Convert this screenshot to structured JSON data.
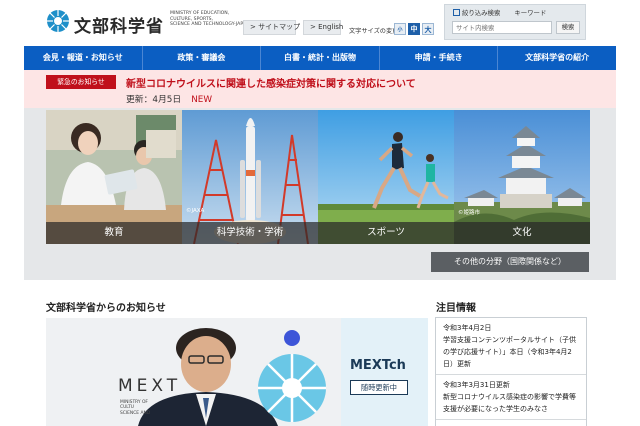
{
  "header": {
    "logo_title": "文部科学省",
    "logo_subtitle": "MINISTRY OF EDUCATION,\nCULTURE, SPORTS,\nSCIENCE AND TECHNOLOGY-JAPAN",
    "sitemap": "> サイトマップ",
    "english": "> English",
    "font_size_label": "文字サイズの変更",
    "font_small": "小",
    "font_mid": "中",
    "font_large": "大",
    "search_tab_1": "絞り込み検索",
    "search_tab_2": "キーワード",
    "search_placeholder": "サイト内検索",
    "search_button": "検索"
  },
  "nav": {
    "items": [
      {
        "label": "会見・報道・お知らせ"
      },
      {
        "label": "政策・審議会"
      },
      {
        "label": "白書・統計・出版物"
      },
      {
        "label": "申請・手続き"
      },
      {
        "label": "文部科学省の紹介"
      }
    ]
  },
  "alert": {
    "badge": "緊急のお知らせ",
    "title": "新型コロナウイルスに関連した感染症対策に関する対応について",
    "date": "更新：4月5日",
    "new_label": "NEW"
  },
  "hero": {
    "tiles": [
      {
        "label": "教育"
      },
      {
        "label": "科学技術・学術",
        "credit": "©JAXA"
      },
      {
        "label": "スポーツ"
      },
      {
        "label": "文化",
        "credit": "©姫路市"
      }
    ],
    "more_button": "その他の分野（国際関係など）"
  },
  "news": {
    "heading": "文部科学省からのお知らせ",
    "banner_mext": "MEXT",
    "banner_mext_sub": "MINISTRY OF\nCULTU\nSCIENCE AND",
    "banner_channel": "MEXTch",
    "banner_channel_note": "随時更新中"
  },
  "topics": {
    "heading": "注目情報",
    "items": [
      {
        "date": "令和3年4月2日",
        "text": "学習支援コンテンツポータルサイト（子供の学び応援サイト）」本日（令和3年4月2日）更新"
      },
      {
        "date": "令和3年3月31日更新",
        "text": "新型コロナウイルス感染症の影響で学費等支援が必要になった学生のみなさ"
      }
    ]
  },
  "colors": {
    "nav": "#0b5ec2",
    "alert_bg": "#fde5e5",
    "alert_red": "#c0101b",
    "hero_bg": "#e5e7e9"
  }
}
